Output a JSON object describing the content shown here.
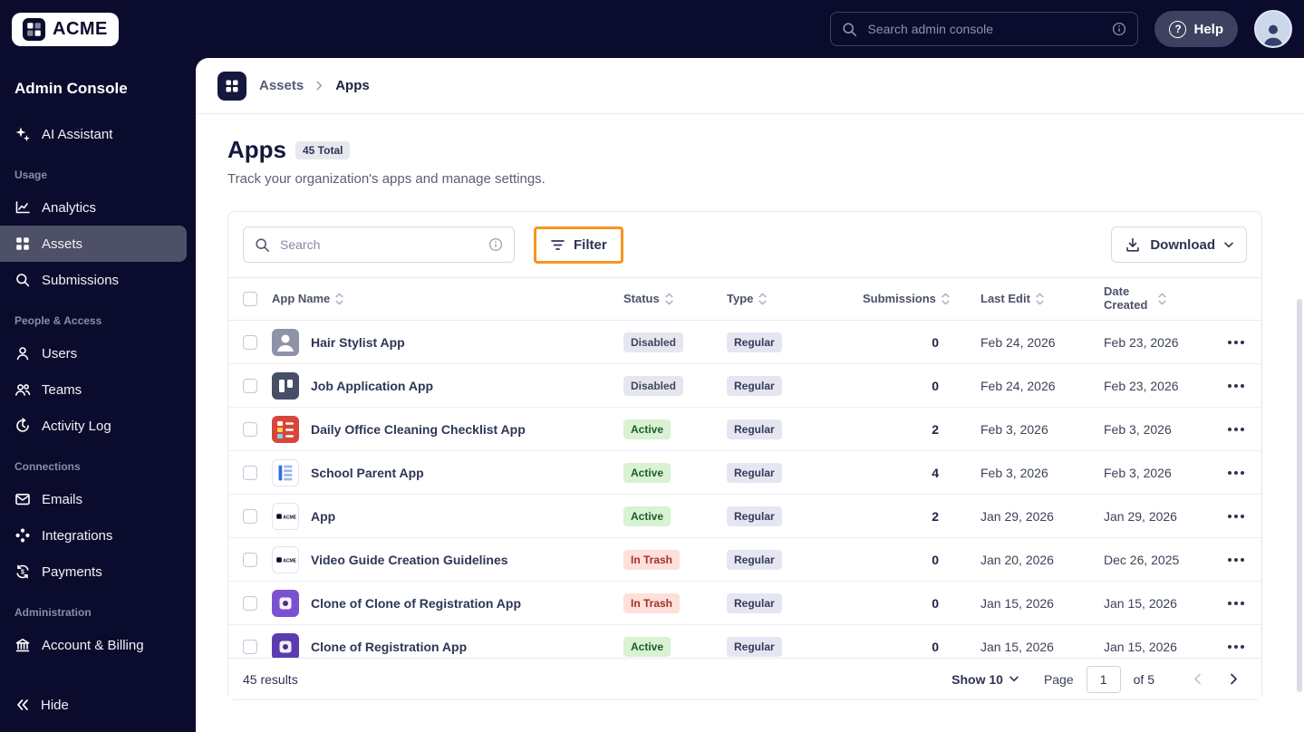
{
  "brand": {
    "name": "ACME"
  },
  "topbar": {
    "search_placeholder": "Search admin console",
    "help_label": "Help"
  },
  "sidebar": {
    "title": "Admin Console",
    "assistant_label": "AI Assistant",
    "sections": [
      {
        "heading": "Usage",
        "items": [
          "Analytics",
          "Assets",
          "Submissions"
        ]
      },
      {
        "heading": "People & Access",
        "items": [
          "Users",
          "Teams",
          "Activity Log"
        ]
      },
      {
        "heading": "Connections",
        "items": [
          "Emails",
          "Integrations",
          "Payments"
        ]
      },
      {
        "heading": "Administration",
        "items": [
          "Account & Billing"
        ]
      }
    ],
    "active_item": "Assets",
    "hide_label": "Hide"
  },
  "breadcrumb": {
    "parent": "Assets",
    "current": "Apps"
  },
  "page": {
    "title": "Apps",
    "total_badge": "45 Total",
    "subtitle": "Track your organization's apps and manage settings."
  },
  "toolbar": {
    "search_placeholder": "Search",
    "filter_label": "Filter",
    "download_label": "Download",
    "highlight_color": "#F7941E"
  },
  "table": {
    "headers": [
      "App Name",
      "Status",
      "Type",
      "Submissions",
      "Last Edit",
      "Date Created"
    ],
    "status_styles": {
      "Disabled": {
        "bg": "#e6e7ee",
        "fg": "#41465e"
      },
      "Active": {
        "bg": "#d8f2d2",
        "fg": "#1c5c2e"
      },
      "In Trash": {
        "bg": "#ffdfda",
        "fg": "#9e3229"
      }
    },
    "type_style": {
      "bg": "#e6e6f2",
      "fg": "#343b58"
    },
    "rows": [
      {
        "name": "Hair Stylist App",
        "status": "Disabled",
        "type": "Regular",
        "submissions": "0",
        "last_edit": "Feb 24, 2026",
        "date_created": "Feb 23, 2026",
        "icon": {
          "kind": "person",
          "bg": "#8e93a8",
          "bordered": false
        }
      },
      {
        "name": "Job Application App",
        "status": "Disabled",
        "type": "Regular",
        "submissions": "0",
        "last_edit": "Feb 24, 2026",
        "date_created": "Feb 23, 2026",
        "icon": {
          "kind": "columns",
          "bg": "#474e66",
          "bordered": false
        }
      },
      {
        "name": "Daily Office Cleaning Checklist App",
        "status": "Active",
        "type": "Regular",
        "submissions": "2",
        "last_edit": "Feb 3, 2026",
        "date_created": "Feb 3, 2026",
        "icon": {
          "kind": "checklist",
          "bg": "#d8453a",
          "bordered": false
        }
      },
      {
        "name": "School Parent App",
        "status": "Active",
        "type": "Regular",
        "submissions": "4",
        "last_edit": "Feb 3, 2026",
        "date_created": "Feb 3, 2026",
        "icon": {
          "kind": "doclines",
          "bg": "#ffffff",
          "bordered": true
        }
      },
      {
        "name": "App",
        "status": "Active",
        "type": "Regular",
        "submissions": "2",
        "last_edit": "Jan 29, 2026",
        "date_created": "Jan 29, 2026",
        "icon": {
          "kind": "acme",
          "bg": "#ffffff",
          "bordered": true
        }
      },
      {
        "name": "Video Guide Creation Guidelines",
        "status": "In Trash",
        "type": "Regular",
        "submissions": "0",
        "last_edit": "Jan 20, 2026",
        "date_created": "Dec 26, 2025",
        "icon": {
          "kind": "acme",
          "bg": "#ffffff",
          "bordered": true
        }
      },
      {
        "name": "Clone of Clone of Registration App",
        "status": "In Trash",
        "type": "Regular",
        "submissions": "0",
        "last_edit": "Jan 15, 2026",
        "date_created": "Jan 15, 2026",
        "icon": {
          "kind": "shape",
          "bg": "#7a52d1",
          "bordered": false
        }
      },
      {
        "name": "Clone of Registration App",
        "status": "Active",
        "type": "Regular",
        "submissions": "0",
        "last_edit": "Jan 15, 2026",
        "date_created": "Jan 15, 2026",
        "icon": {
          "kind": "shape",
          "bg": "#5a3cae",
          "bordered": false
        }
      }
    ]
  },
  "pagination": {
    "results": "45 results",
    "show_label": "Show 10",
    "page_label": "Page",
    "page_value": "1",
    "of_label": "of 5"
  }
}
